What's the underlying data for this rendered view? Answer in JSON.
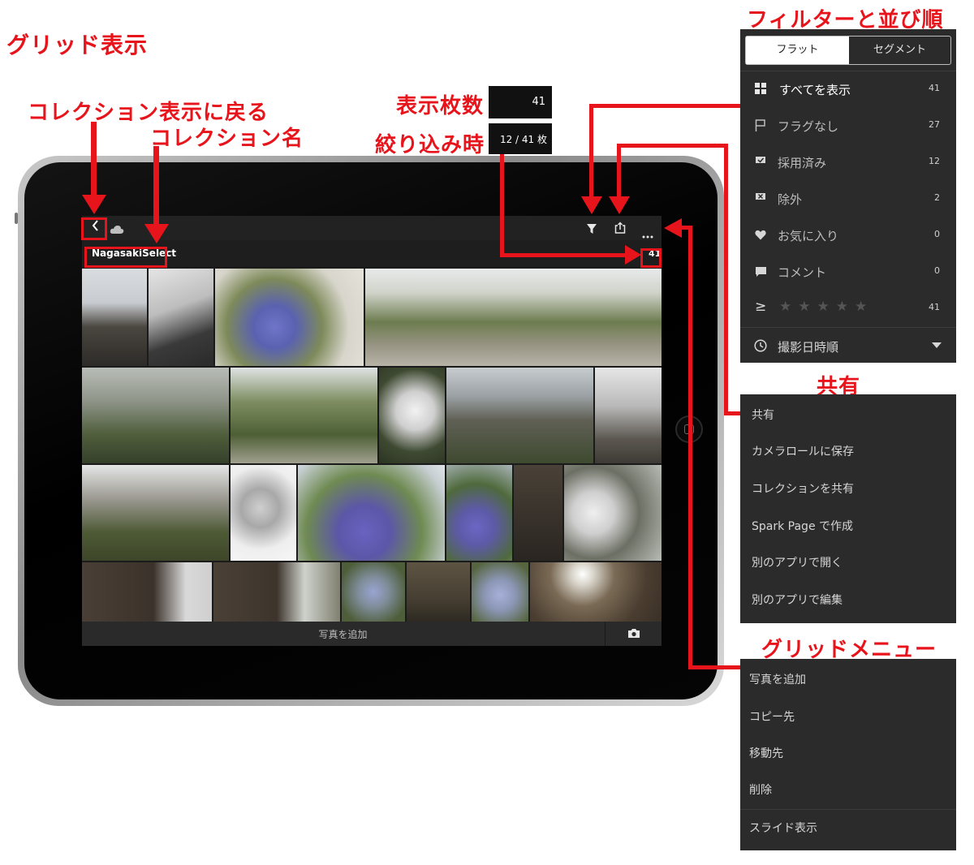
{
  "callouts": {
    "grid_view": "グリッド表示",
    "back_to_collections": "コレクション表示に戻る",
    "collection_name": "コレクション名",
    "display_count": "表示枚数",
    "when_filtered": "絞り込み時",
    "filter_sort": "フィルターと並び順",
    "share": "共有",
    "grid_menu": "グリッドメニュー"
  },
  "info_boxes": {
    "display_count_value": "41",
    "filtered_value": "12 / 41 枚"
  },
  "app": {
    "collection_name": "NagasakiSelect",
    "photo_count": "41",
    "add_photos": "写真を追加",
    "icons": [
      "back-chevron-icon",
      "cloud-icon",
      "filter-icon",
      "share-icon",
      "more-icon",
      "camera-icon"
    ]
  },
  "filter_panel": {
    "tabs": [
      "フラット",
      "セグメント"
    ],
    "rows": [
      {
        "icon": "grid-icon",
        "label": "すべてを表示",
        "count": "41"
      },
      {
        "icon": "flag-outline-icon",
        "label": "フラグなし",
        "count": "27"
      },
      {
        "icon": "flag-picked-icon",
        "label": "採用済み",
        "count": "12"
      },
      {
        "icon": "flag-rejected-icon",
        "label": "除外",
        "count": "2"
      },
      {
        "icon": "heart-icon",
        "label": "お気に入り",
        "count": "0"
      },
      {
        "icon": "comment-icon",
        "label": "コメント",
        "count": "0"
      }
    ],
    "rating": {
      "symbol": "≥",
      "stars": 5,
      "count": "41"
    },
    "sort": {
      "icon": "clock-icon",
      "label": "撮影日時順"
    }
  },
  "share_menu": {
    "items": [
      "共有",
      "カメラロールに保存",
      "コレクションを共有",
      "Spark Page で作成",
      "別のアプリで開く",
      "別のアプリで編集"
    ]
  },
  "grid_menu": {
    "items": [
      "写真を追加",
      "コピー先",
      "移動先",
      "削除",
      "スライド表示"
    ]
  },
  "colors": {
    "accent_red": "#e8141b",
    "panel_bg": "#2b2b2b",
    "screen_bg": "#1b1b1b"
  }
}
